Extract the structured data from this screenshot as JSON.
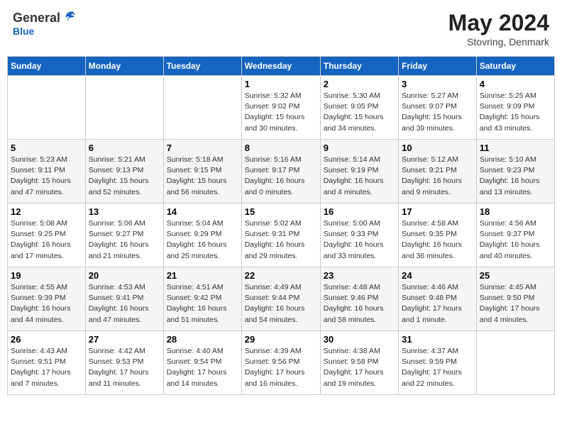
{
  "header": {
    "logo_general": "General",
    "logo_blue": "Blue",
    "month_title": "May 2024",
    "location": "Stovring, Denmark"
  },
  "columns": [
    "Sunday",
    "Monday",
    "Tuesday",
    "Wednesday",
    "Thursday",
    "Friday",
    "Saturday"
  ],
  "weeks": [
    {
      "days": [
        {
          "number": "",
          "info": ""
        },
        {
          "number": "",
          "info": ""
        },
        {
          "number": "",
          "info": ""
        },
        {
          "number": "1",
          "info": "Sunrise: 5:32 AM\nSunset: 9:02 PM\nDaylight: 15 hours\nand 30 minutes."
        },
        {
          "number": "2",
          "info": "Sunrise: 5:30 AM\nSunset: 9:05 PM\nDaylight: 15 hours\nand 34 minutes."
        },
        {
          "number": "3",
          "info": "Sunrise: 5:27 AM\nSunset: 9:07 PM\nDaylight: 15 hours\nand 39 minutes."
        },
        {
          "number": "4",
          "info": "Sunrise: 5:25 AM\nSunset: 9:09 PM\nDaylight: 15 hours\nand 43 minutes."
        }
      ]
    },
    {
      "days": [
        {
          "number": "5",
          "info": "Sunrise: 5:23 AM\nSunset: 9:11 PM\nDaylight: 15 hours\nand 47 minutes."
        },
        {
          "number": "6",
          "info": "Sunrise: 5:21 AM\nSunset: 9:13 PM\nDaylight: 15 hours\nand 52 minutes."
        },
        {
          "number": "7",
          "info": "Sunrise: 5:18 AM\nSunset: 9:15 PM\nDaylight: 15 hours\nand 56 minutes."
        },
        {
          "number": "8",
          "info": "Sunrise: 5:16 AM\nSunset: 9:17 PM\nDaylight: 16 hours\nand 0 minutes."
        },
        {
          "number": "9",
          "info": "Sunrise: 5:14 AM\nSunset: 9:19 PM\nDaylight: 16 hours\nand 4 minutes."
        },
        {
          "number": "10",
          "info": "Sunrise: 5:12 AM\nSunset: 9:21 PM\nDaylight: 16 hours\nand 9 minutes."
        },
        {
          "number": "11",
          "info": "Sunrise: 5:10 AM\nSunset: 9:23 PM\nDaylight: 16 hours\nand 13 minutes."
        }
      ]
    },
    {
      "days": [
        {
          "number": "12",
          "info": "Sunrise: 5:08 AM\nSunset: 9:25 PM\nDaylight: 16 hours\nand 17 minutes."
        },
        {
          "number": "13",
          "info": "Sunrise: 5:06 AM\nSunset: 9:27 PM\nDaylight: 16 hours\nand 21 minutes."
        },
        {
          "number": "14",
          "info": "Sunrise: 5:04 AM\nSunset: 9:29 PM\nDaylight: 16 hours\nand 25 minutes."
        },
        {
          "number": "15",
          "info": "Sunrise: 5:02 AM\nSunset: 9:31 PM\nDaylight: 16 hours\nand 29 minutes."
        },
        {
          "number": "16",
          "info": "Sunrise: 5:00 AM\nSunset: 9:33 PM\nDaylight: 16 hours\nand 33 minutes."
        },
        {
          "number": "17",
          "info": "Sunrise: 4:58 AM\nSunset: 9:35 PM\nDaylight: 16 hours\nand 36 minutes."
        },
        {
          "number": "18",
          "info": "Sunrise: 4:56 AM\nSunset: 9:37 PM\nDaylight: 16 hours\nand 40 minutes."
        }
      ]
    },
    {
      "days": [
        {
          "number": "19",
          "info": "Sunrise: 4:55 AM\nSunset: 9:39 PM\nDaylight: 16 hours\nand 44 minutes."
        },
        {
          "number": "20",
          "info": "Sunrise: 4:53 AM\nSunset: 9:41 PM\nDaylight: 16 hours\nand 47 minutes."
        },
        {
          "number": "21",
          "info": "Sunrise: 4:51 AM\nSunset: 9:42 PM\nDaylight: 16 hours\nand 51 minutes."
        },
        {
          "number": "22",
          "info": "Sunrise: 4:49 AM\nSunset: 9:44 PM\nDaylight: 16 hours\nand 54 minutes."
        },
        {
          "number": "23",
          "info": "Sunrise: 4:48 AM\nSunset: 9:46 PM\nDaylight: 16 hours\nand 58 minutes."
        },
        {
          "number": "24",
          "info": "Sunrise: 4:46 AM\nSunset: 9:48 PM\nDaylight: 17 hours\nand 1 minute."
        },
        {
          "number": "25",
          "info": "Sunrise: 4:45 AM\nSunset: 9:50 PM\nDaylight: 17 hours\nand 4 minutes."
        }
      ]
    },
    {
      "days": [
        {
          "number": "26",
          "info": "Sunrise: 4:43 AM\nSunset: 9:51 PM\nDaylight: 17 hours\nand 7 minutes."
        },
        {
          "number": "27",
          "info": "Sunrise: 4:42 AM\nSunset: 9:53 PM\nDaylight: 17 hours\nand 11 minutes."
        },
        {
          "number": "28",
          "info": "Sunrise: 4:40 AM\nSunset: 9:54 PM\nDaylight: 17 hours\nand 14 minutes."
        },
        {
          "number": "29",
          "info": "Sunrise: 4:39 AM\nSunset: 9:56 PM\nDaylight: 17 hours\nand 16 minutes."
        },
        {
          "number": "30",
          "info": "Sunrise: 4:38 AM\nSunset: 9:58 PM\nDaylight: 17 hours\nand 19 minutes."
        },
        {
          "number": "31",
          "info": "Sunrise: 4:37 AM\nSunset: 9:59 PM\nDaylight: 17 hours\nand 22 minutes."
        },
        {
          "number": "",
          "info": ""
        }
      ]
    }
  ]
}
